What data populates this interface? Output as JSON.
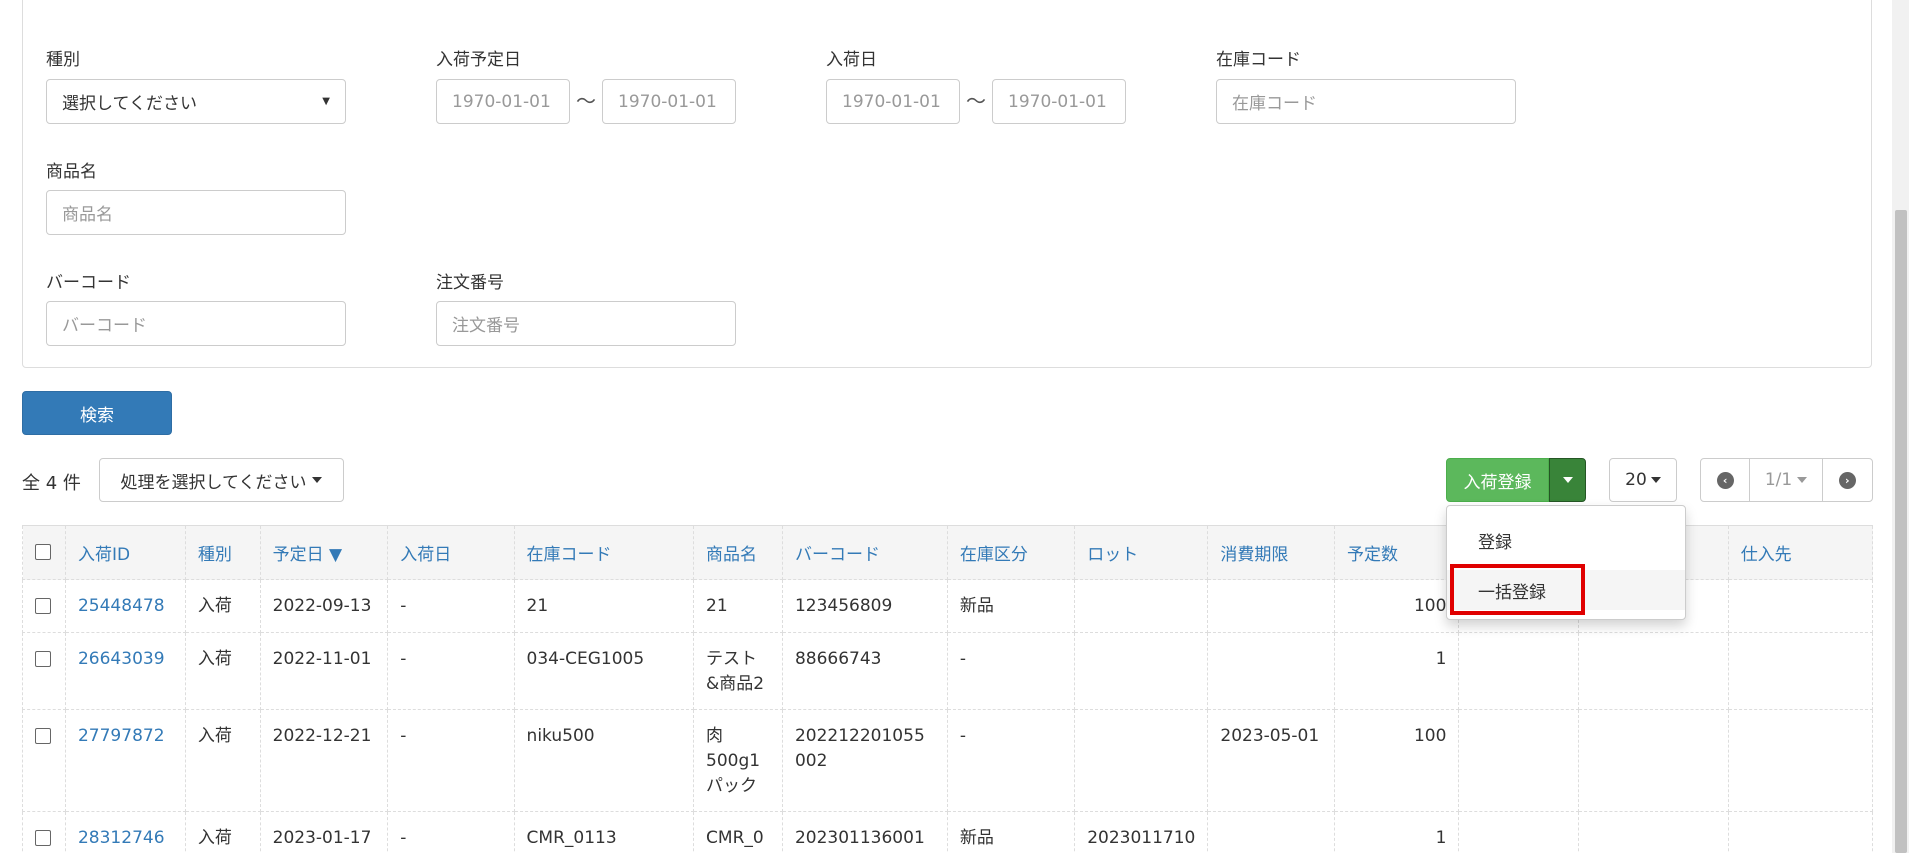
{
  "filters": {
    "type_label": "種別",
    "type_value": "選択してください",
    "scheduled_date_label": "入荷予定日",
    "scheduled_from_placeholder": "1970-01-01",
    "scheduled_to_placeholder": "1970-01-01",
    "arrival_date_label": "入荷日",
    "arrival_from_placeholder": "1970-01-01",
    "arrival_to_placeholder": "1970-01-01",
    "stock_code_label": "在庫コード",
    "stock_code_placeholder": "在庫コード",
    "product_name_label": "商品名",
    "product_name_placeholder": "商品名",
    "barcode_label": "バーコード",
    "barcode_placeholder": "バーコード",
    "order_no_label": "注文番号",
    "order_no_placeholder": "注文番号",
    "tilde": "〜"
  },
  "search_button": "検索",
  "toolbar": {
    "total": "全 4 件",
    "action_select": "処理を選択してください",
    "register_button": "入荷登録",
    "per_page": "20",
    "page_indicator": "1/1"
  },
  "register_menu": {
    "items": [
      "登録",
      "一括登録"
    ]
  },
  "table": {
    "headers": [
      "入荷ID",
      "種別",
      "予定日 ▼",
      "入荷日",
      "在庫コード",
      "商品名",
      "バーコード",
      "在庫区分",
      "ロット",
      "消費期限",
      "予定数",
      "",
      "",
      "仕入先"
    ],
    "rows": [
      [
        "25448478",
        "入荷",
        "2022-09-13",
        "-",
        "21",
        "21",
        "123456809",
        "新品",
        "",
        "",
        "100",
        "",
        "",
        ""
      ],
      [
        "26643039",
        "入荷",
        "2022-11-01",
        "-",
        "034-CEG1005",
        "テスト&商品2",
        "88666743",
        "-",
        "",
        "",
        "1",
        "",
        "",
        ""
      ],
      [
        "27797872",
        "入荷",
        "2022-12-21",
        "-",
        "niku500",
        "肉500g1パック",
        "202212201055002",
        "-",
        "",
        "2023-05-01",
        "100",
        "",
        "",
        ""
      ],
      [
        "28312746",
        "入荷",
        "2023-01-17",
        "-",
        "CMR_0113",
        "CMR_0",
        "202301136001",
        "新品",
        "2023011710",
        "",
        "1",
        "",
        "",
        ""
      ]
    ]
  }
}
